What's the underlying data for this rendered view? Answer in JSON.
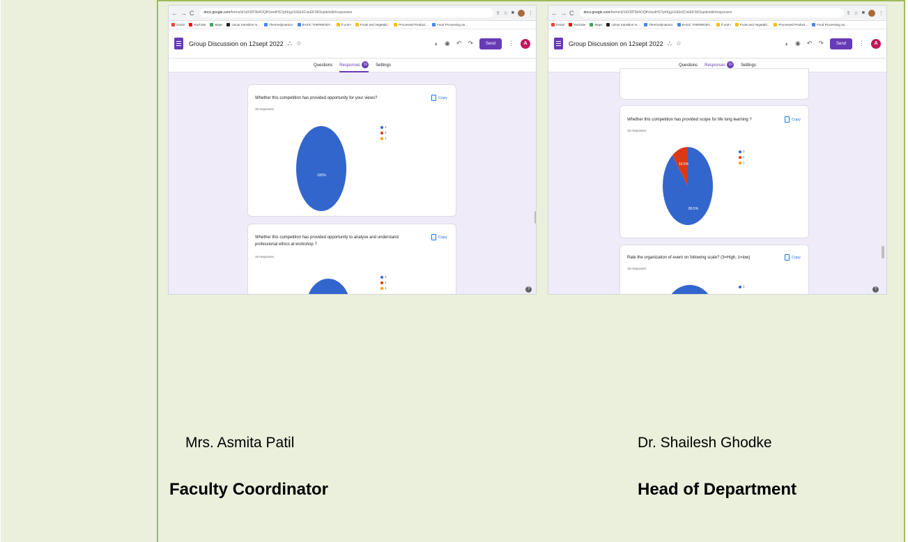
{
  "screenshots": [
    {
      "browser": {
        "url_host": "docs.google.com",
        "url_path": "/forms/d/1dXDP3b4OQfh3xwtHS7phKgyi1IiEbXCnkEKSK9upik/edit#responses",
        "bookmarks": [
          "Gmail",
          "YouTube",
          "Maps",
          "colour transition m...",
          "Thermodynamics",
          "BASIC THERMODY...",
          "ft unit-I",
          "Fruits and Vegetabl...",
          "Processed Product...",
          "Food Processing an..."
        ]
      },
      "form": {
        "title": "Group Discussion on 12sept 2022",
        "send_label": "Send",
        "account_initial": "A",
        "tabs": [
          "Questions",
          "Responses",
          "Settings"
        ],
        "response_count": "19"
      },
      "cards": [
        {
          "question": "Whether this competition has provided opportunity for your views?",
          "responses": "19 responses",
          "copy_label": "Copy",
          "legend": [
            "3",
            "2",
            "1"
          ],
          "chart_data": {
            "type": "pie",
            "categories": [
              "3",
              "2",
              "1"
            ],
            "values": [
              100,
              0,
              0
            ],
            "colors": [
              "#3366cc",
              "#dc3912",
              "#ff9900"
            ],
            "labels": [
              "100%"
            ]
          }
        },
        {
          "question_line1": "Whether this competition has provided opportunity to analyse and understand",
          "question_line2": "professional ethics at workshop ?",
          "responses": "19 responses",
          "copy_label": "Copy",
          "legend": [
            "3",
            "2",
            "1"
          ]
        }
      ]
    },
    {
      "browser": {
        "url_host": "docs.google.com",
        "url_path": "/forms/d/1dXDP3b4OQfh3xwtHS7phKgyi1IiEbXCnkEKSK9upik/edit#responses",
        "bookmarks": [
          "Gmail",
          "YouTube",
          "Maps",
          "colour transition m...",
          "Thermodynamics",
          "BASIC THERMODY...",
          "ft unit-I",
          "Fruits and Vegetabl...",
          "Processed Product...",
          "Food Processing an..."
        ]
      },
      "form": {
        "title": "Group Discussion on 12sept 2022",
        "send_label": "Send",
        "account_initial": "A",
        "tabs": [
          "Questions",
          "Responses",
          "Settings"
        ],
        "response_count": "19"
      },
      "cards": [
        {
          "question": "Whether this competition has provided scope for life long learning ?",
          "responses": "19 responses",
          "copy_label": "Copy",
          "legend": [
            "3",
            "2",
            "1"
          ],
          "chart_data": {
            "type": "pie",
            "categories": [
              "3",
              "2",
              "1"
            ],
            "values": [
              89.5,
              10.5,
              0
            ],
            "colors": [
              "#3366cc",
              "#dc3912",
              "#ff9900"
            ],
            "labels": [
              "89.5%",
              "10.5%"
            ]
          }
        },
        {
          "question": "Rate the organization of event on following scale? (3=High, 1=low)",
          "responses": "19 responses",
          "copy_label": "Copy",
          "legend": [
            "3"
          ]
        }
      ]
    }
  ],
  "signatures": {
    "left_name": "Mrs. Asmita Patil",
    "left_role": "Faculty Coordinator",
    "right_name": "Dr. Shailesh Ghodke",
    "right_role": "Head of Department"
  }
}
